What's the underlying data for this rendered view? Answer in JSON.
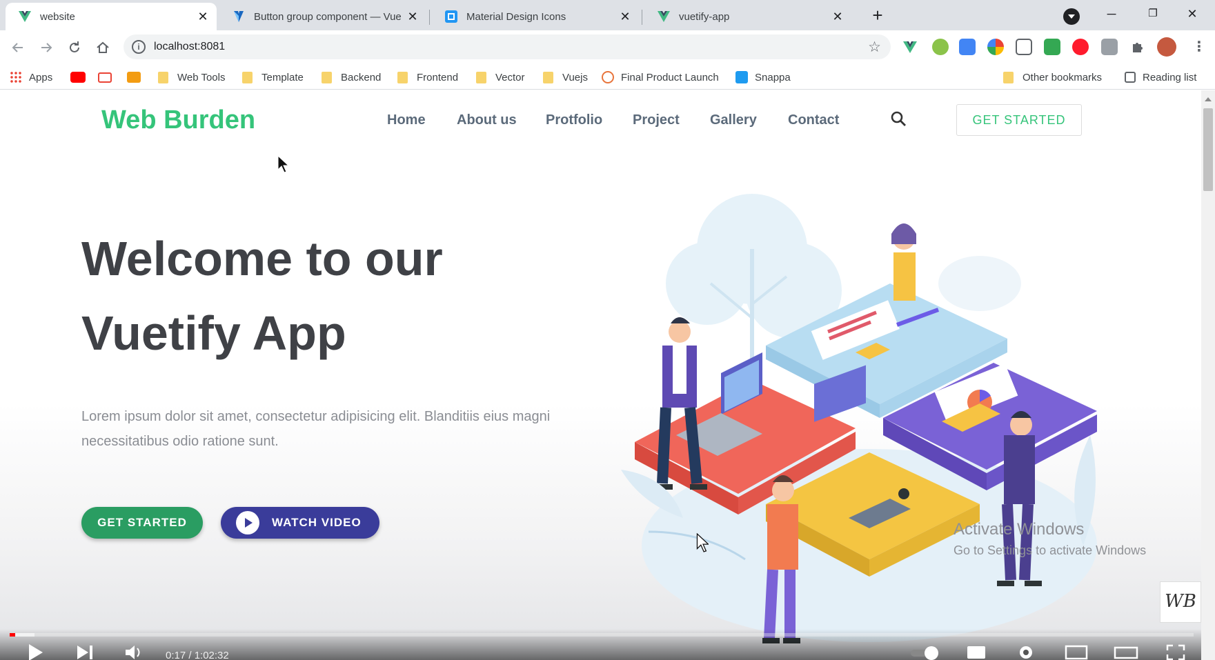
{
  "browser": {
    "tabs": [
      {
        "title": "website",
        "active": true
      },
      {
        "title": "Button group component — Vue",
        "active": false
      },
      {
        "title": "Material Design Icons",
        "active": false
      },
      {
        "title": "vuetify-app",
        "active": false
      }
    ],
    "address": "localhost:8081",
    "bookmarks": [
      "Apps",
      "Web Tools",
      "Template",
      "Backend",
      "Frontend",
      "Vector",
      "Vuejs",
      "Final Product Launch",
      "Snappa"
    ],
    "bookmarks_right": [
      "Other bookmarks",
      "Reading list"
    ]
  },
  "app": {
    "brand": "Web Burden",
    "nav": [
      "Home",
      "About us",
      "Protfolio",
      "Project",
      "Gallery",
      "Contact"
    ],
    "cta": "GET STARTED"
  },
  "hero": {
    "title_line1": "Welcome to our",
    "title_line2": "Vuetify App",
    "text": "Lorem ipsum dolor sit amet, consectetur adipisicing elit. Blanditiis eius magni necessitatibus odio ratione sunt.",
    "primary_button": "GET STARTED",
    "video_button": "WATCH VIDEO"
  },
  "overlay": {
    "activate_title": "Activate Windows",
    "activate_sub": "Go to Settings to activate Windows",
    "channel_logo": "WB"
  },
  "player": {
    "time": "0:17 / 1:02:32",
    "progress_fraction": 0.0045
  },
  "colors": {
    "brand": "#35c47a",
    "primary_button": "#2a9d62",
    "video_button": "#3a3c9a",
    "nav_text": "#5b6a7a",
    "heading": "#3f4146"
  }
}
